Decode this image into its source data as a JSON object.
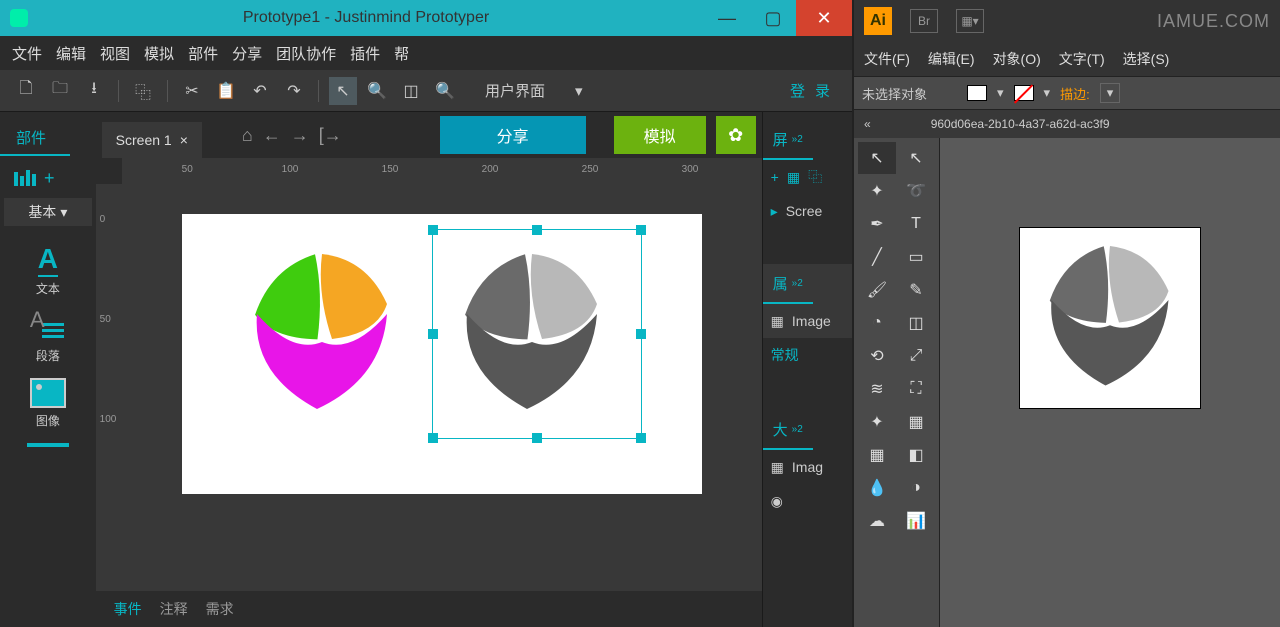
{
  "justinmind": {
    "title": "Prototype1 - Justinmind Prototyper",
    "menu": [
      "文件",
      "编辑",
      "视图",
      "模拟",
      "部件",
      "分享",
      "团队协作",
      "插件",
      "帮"
    ],
    "dropdown": "用户界面",
    "login": "登录",
    "sidebar": {
      "tab": "部件",
      "basic": "基本",
      "widgets": {
        "text": "文本",
        "para": "段落",
        "image": "图像"
      }
    },
    "tab_name": "Screen 1",
    "share_btn": "分享",
    "sim_btn": "模拟",
    "ruler_h": [
      "50",
      "100",
      "150",
      "200",
      "250",
      "300"
    ],
    "ruler_v": [
      "0",
      "50",
      "100"
    ],
    "bottom_tabs": [
      "事件",
      "注释",
      "需求"
    ],
    "right": {
      "screen_tab": "屏",
      "screen_item": "Scree",
      "prop_tab": "属",
      "image_label": "Image",
      "normal": "常规",
      "size_tab": "大",
      "imag": "Imag"
    }
  },
  "illustrator": {
    "logo": "Ai",
    "br": "Br",
    "watermark": "IAMUE.COM",
    "menu": [
      "文件(F)",
      "编辑(E)",
      "对象(O)",
      "文字(T)",
      "选择(S)"
    ],
    "no_select": "未选择对象",
    "stroke": "描边:",
    "doc": "960d06ea-2b10-4a37-a62d-ac3f9"
  }
}
